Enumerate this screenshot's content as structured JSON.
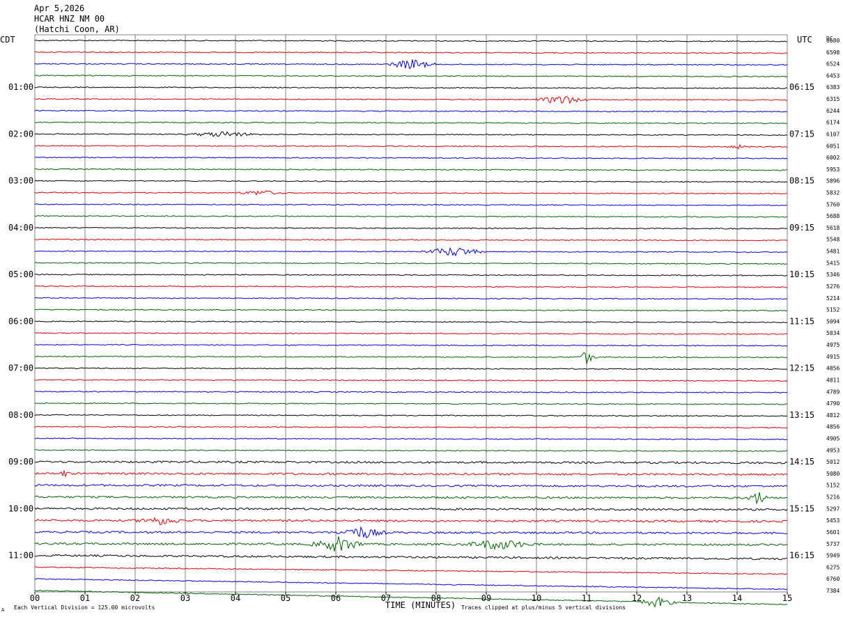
{
  "header": {
    "date": "Apr 5,2026",
    "station": "HCAR HNZ NM 00",
    "location": "(Hatchi Coon, AR)"
  },
  "labels": {
    "left_timezone": "CDT",
    "right_timezone": "UTC",
    "dc_label": "DC",
    "x_title": "TIME (MINUTES)",
    "footer_left": "Each Vertical Division =  125.00 microvolts",
    "footer_right": "Traces clipped at plus/minus 5 vertical divisions",
    "corner_mark": "A"
  },
  "colors": {
    "trace_cycle": [
      "#000000",
      "#e00000",
      "#0000e0",
      "#006400"
    ],
    "grid": "#808080",
    "text": "#000000"
  },
  "chart_data": {
    "type": "line",
    "title": "",
    "xlabel": "TIME (MINUTES)",
    "ylabel": "",
    "x_range": [
      0,
      15
    ],
    "x_ticks": [
      "00",
      "01",
      "02",
      "03",
      "04",
      "05",
      "06",
      "07",
      "08",
      "09",
      "10",
      "11",
      "12",
      "13",
      "14",
      "15"
    ],
    "grid": true,
    "rows_per_hour": 4,
    "left_time_labels": [
      "01:00",
      "02:00",
      "03:00",
      "04:00",
      "05:00",
      "06:00",
      "07:00",
      "08:00",
      "09:00",
      "10:00",
      "11:00"
    ],
    "right_time_labels": [
      "06:15",
      "07:15",
      "08:15",
      "09:15",
      "10:15",
      "11:15",
      "12:15",
      "13:15",
      "14:15",
      "15:15",
      "16:15"
    ],
    "dc_offsets": [
      6680,
      6598,
      6524,
      6453,
      6383,
      6315,
      6244,
      6174,
      6107,
      6051,
      6002,
      5953,
      5896,
      5832,
      5760,
      5688,
      5618,
      5548,
      5481,
      5415,
      5346,
      5276,
      5214,
      5152,
      5094,
      5034,
      4975,
      4915,
      4856,
      4811,
      4789,
      4790,
      4812,
      4856,
      4905,
      4953,
      5012,
      5080,
      5152,
      5216,
      5297,
      5453,
      5601,
      5737,
      5949,
      6275,
      6760,
      7384
    ],
    "events": [
      {
        "row": 2,
        "start_min": 7.0,
        "end_min": 8.0,
        "amplitude": 0.5
      },
      {
        "row": 5,
        "start_min": 10.0,
        "end_min": 11.0,
        "amplitude": 0.45
      },
      {
        "row": 8,
        "start_min": 3.0,
        "end_min": 4.5,
        "amplitude": 0.25
      },
      {
        "row": 9,
        "start_min": 13.8,
        "end_min": 14.3,
        "amplitude": 0.15
      },
      {
        "row": 13,
        "start_min": 4.0,
        "end_min": 5.0,
        "amplitude": 0.22
      },
      {
        "row": 18,
        "start_min": 7.7,
        "end_min": 9.0,
        "amplitude": 0.45
      },
      {
        "row": 27,
        "start_min": 10.8,
        "end_min": 11.2,
        "amplitude": 0.6
      },
      {
        "row": 37,
        "start_min": 0.5,
        "end_min": 0.7,
        "amplitude": 0.3
      },
      {
        "row": 39,
        "start_min": 14.2,
        "end_min": 14.6,
        "amplitude": 0.65
      },
      {
        "row": 41,
        "start_min": 2.0,
        "end_min": 3.0,
        "amplitude": 0.35
      },
      {
        "row": 42,
        "start_min": 6.0,
        "end_min": 7.0,
        "amplitude": 0.55
      },
      {
        "row": 43,
        "start_min": 5.5,
        "end_min": 6.6,
        "amplitude": 0.7
      },
      {
        "row": 43,
        "start_min": 8.5,
        "end_min": 10.0,
        "amplitude": 0.45
      },
      {
        "row": 47,
        "start_min": 12.0,
        "end_min": 12.8,
        "amplitude": 0.5
      }
    ]
  }
}
